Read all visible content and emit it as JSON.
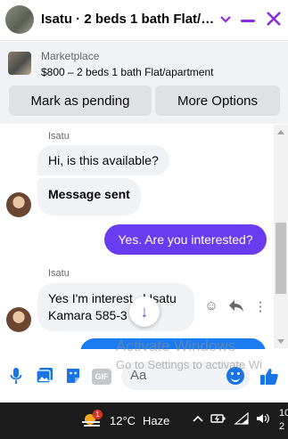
{
  "header": {
    "title": "Isatu · 2 beds 1 bath Flat/a...",
    "chevron_icon": "chevron-down-icon",
    "minimize_icon": "minimize-icon",
    "close_icon": "close-icon",
    "accent": "#8a2be2"
  },
  "marketplace": {
    "label": "Marketplace",
    "listing": "$800 – 2 beds 1 bath Flat/apartment",
    "pending_button": "Mark as pending",
    "more_button": "More Options"
  },
  "conversation": {
    "messages": [
      {
        "sender": "Isatu",
        "text": "Hi, is this available?",
        "direction": "in"
      },
      {
        "text": "Message sent",
        "direction": "in",
        "bold": true
      },
      {
        "text": "Yes. Are you interested?",
        "direction": "out"
      },
      {
        "sender": "Isatu",
        "line1": "Yes I'm interest   l Isatu",
        "line2": "Kamara 585-3     56",
        "direction": "in"
      }
    ],
    "actions": {
      "react": "☺",
      "reply": "↩",
      "more": "⋮"
    },
    "jump_icon": "↓",
    "outgoing_color": "#6a3cf0"
  },
  "watermark": {
    "line1": "Activate Windows",
    "line2": "Go to Settings to activate Wi"
  },
  "composer": {
    "placeholder": "Aa",
    "icons": [
      "microphone-icon",
      "image-icon",
      "sticker-icon",
      "gif-icon",
      "emoji-icon",
      "like-icon"
    ],
    "gif_label": "GIF",
    "brand_color": "#1b74e4"
  },
  "taskbar": {
    "weather_badge": "1",
    "temperature": "12°C",
    "condition": "Haze",
    "tray_up": "^",
    "time_fragment": "10",
    "date_fragment": "2"
  }
}
